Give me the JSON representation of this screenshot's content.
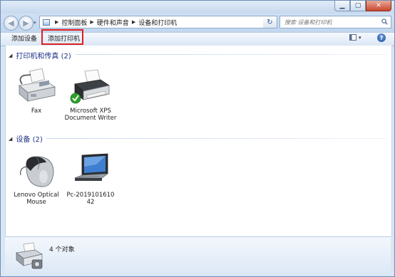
{
  "window": {
    "minimize_glyph": "▁",
    "maximize_glyph": "▢",
    "close_glyph": "✕"
  },
  "nav": {
    "back_glyph": "◀",
    "forward_glyph": "▶",
    "dropdown_glyph": "▾"
  },
  "address": {
    "breadcrumbs": [
      "控制面板",
      "硬件和声音",
      "设备和打印机"
    ],
    "separator": "▶",
    "dropdown_glyph": "▾",
    "refresh_glyph": "↻"
  },
  "search": {
    "placeholder": "搜索 设备和打印机"
  },
  "toolbar": {
    "add_device": "添加设备",
    "add_printer": "添加打印机",
    "view_dropdown_glyph": "▾",
    "help_glyph": "?"
  },
  "groups": {
    "printers": {
      "collapse_glyph": "◢",
      "title": "打印机和传真 (2)",
      "items": [
        {
          "label": "Fax",
          "icon": "fax-icon"
        },
        {
          "label": "Microsoft XPS Document Writer",
          "icon": "printer-icon"
        }
      ]
    },
    "devices": {
      "collapse_glyph": "◢",
      "title": "设备 (2)",
      "items": [
        {
          "label": "Lenovo Optical Mouse",
          "icon": "mouse-icon"
        },
        {
          "label": "Pc-2019101610 42",
          "icon": "laptop-icon"
        }
      ]
    }
  },
  "details": {
    "count": "4 个对象",
    "icon": "devices-printers-icon"
  },
  "colors": {
    "group_header": "#1e3287",
    "highlight_box": "#e02020",
    "default_check": "#2fa02f"
  }
}
